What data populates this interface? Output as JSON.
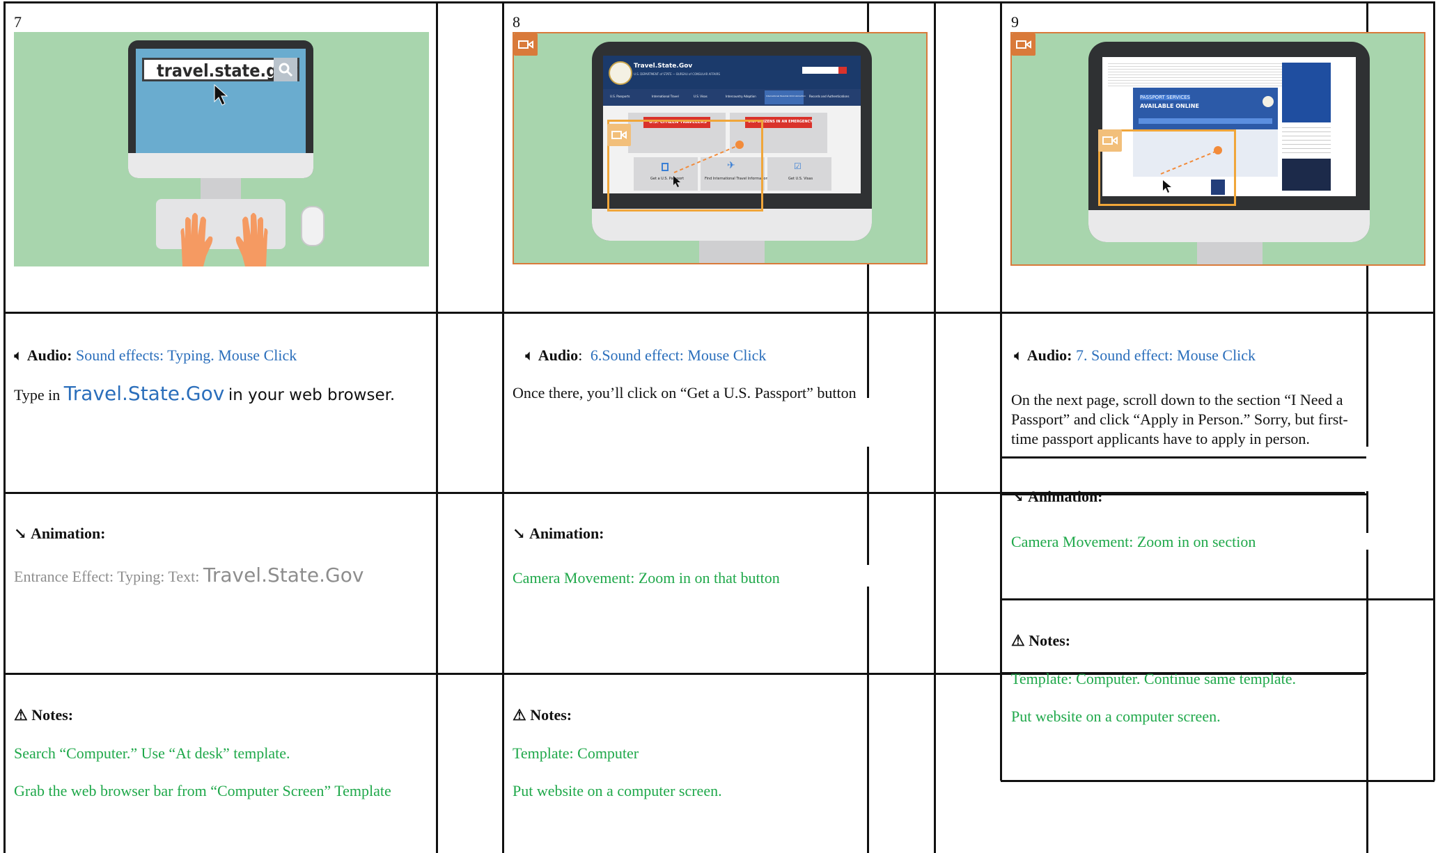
{
  "panels": [
    {
      "number": "7",
      "scene": {
        "browser_url": "travel.state.gov"
      },
      "audio": {
        "label": "Audio:",
        "value": "Sound effects: Typing. Mouse Click",
        "script_prefix": "Type in",
        "script_highlight": "Travel.State.Gov",
        "script_suffix": "in your web browser."
      },
      "animation": {
        "label": "Animation:",
        "prefix": "Entrance Effect: Typing:  Text:",
        "highlight": "Travel.State.Gov"
      },
      "notes": {
        "label": "Notes:",
        "lines": [
          "Search “Computer.” Use “At desk” template.",
          "Grab the web browser bar from “Computer Screen” Template"
        ]
      }
    },
    {
      "number": "8",
      "scene": {
        "site_name": "Travel.State.Gov",
        "site_sub": "U.S. DEPARTMENT of STATE — BUREAU of CONSULAR AFFAIRS",
        "nav": [
          "U.S. Passports",
          "International Travel",
          "U.S. Visas",
          "Intercountry Adoption",
          "International Parental Child Abduction",
          "Records and Authentications"
        ],
        "card_left_title": "U.S. CITIZEN TRAVELERS",
        "card_right_title": "U.S. CITIZENS IN AN EMERGENCY",
        "tile_1": "Get a U.S. Passport",
        "tile_2": "Find International Travel Information",
        "tile_3": "Get U.S. Visas"
      },
      "audio": {
        "label": "Audio",
        "value": "6.Sound effect: Mouse Click",
        "script": "Once there, you’ll click on “Get a U.S. Passport” button"
      },
      "animation": {
        "label": "Animation:",
        "value": "Camera Movement: Zoom in on that button"
      },
      "notes": {
        "label": "Notes:",
        "lines": [
          "Template: Computer",
          "Put website on a computer screen."
        ]
      }
    },
    {
      "number": "9",
      "scene": {
        "banner_line1": "PASSPORT SERVICES",
        "banner_line2": "AVAILABLE ONLINE"
      },
      "audio": {
        "label": "Audio:",
        "value": "7. Sound effect: Mouse Click",
        "script": "On the next page, scroll down to the section “I Need a Passport” and click “Apply in Person.” Sorry, but first-time passport applicants have to apply in person."
      },
      "animation": {
        "label": "Animation:",
        "value": "Camera Movement: Zoom in on section"
      },
      "notes": {
        "label": "Notes:",
        "lines": [
          "Template: Computer. Continue same template.",
          "Put website on a computer screen."
        ]
      }
    }
  ],
  "colors": {
    "scene_green": "#a8d5ad",
    "link_blue": "#2a6ebb",
    "note_green": "#1fa84a",
    "camera_orange": "#d97a3a"
  }
}
